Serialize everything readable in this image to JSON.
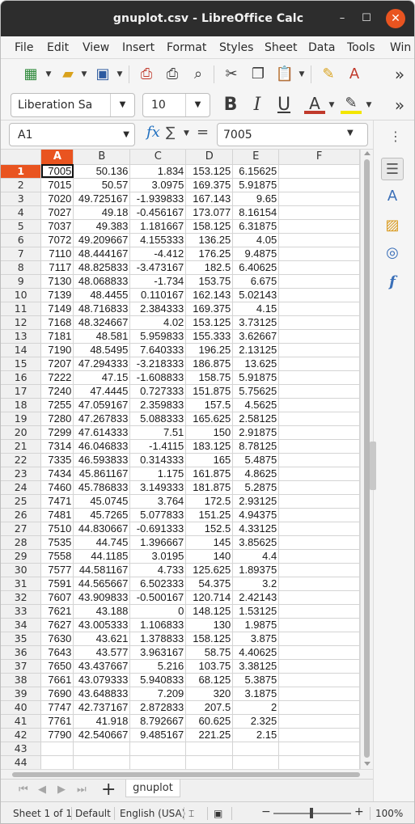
{
  "window": {
    "title": "gnuplot.csv - LibreOffice Calc",
    "min_glyph": "–",
    "max_glyph": "☐",
    "close_glyph": "✕"
  },
  "menu": [
    "File",
    "Edit",
    "View",
    "Insert",
    "Format",
    "Styles",
    "Sheet",
    "Data",
    "Tools",
    "Win"
  ],
  "toolbar": {
    "overflow": "»",
    "font_name": "Liberation Sa",
    "font_size": "10",
    "bold": "B",
    "italic": "I",
    "underline": "U"
  },
  "formula_bar": {
    "cell_ref": "A1",
    "fx": "fx",
    "sigma": "∑",
    "equals": "=",
    "value": "7005"
  },
  "grid": {
    "columns": [
      "A",
      "B",
      "C",
      "D",
      "E",
      "F"
    ],
    "rows": [
      [
        "1",
        "7005",
        "50.136",
        "1.834",
        "153.125",
        "6.15625",
        ""
      ],
      [
        "2",
        "7015",
        "50.57",
        "3.0975",
        "169.375",
        "5.91875",
        ""
      ],
      [
        "3",
        "7020",
        "49.725167",
        "-1.939833",
        "167.143",
        "9.65",
        ""
      ],
      [
        "4",
        "7027",
        "49.18",
        "-0.456167",
        "173.077",
        "8.16154",
        ""
      ],
      [
        "5",
        "7037",
        "49.383",
        "1.181667",
        "158.125",
        "6.31875",
        ""
      ],
      [
        "6",
        "7072",
        "49.209667",
        "4.155333",
        "136.25",
        "4.05",
        ""
      ],
      [
        "7",
        "7110",
        "48.444167",
        "-4.412",
        "176.25",
        "9.4875",
        ""
      ],
      [
        "8",
        "7117",
        "48.825833",
        "-3.473167",
        "182.5",
        "6.40625",
        ""
      ],
      [
        "9",
        "7130",
        "48.068833",
        "-1.734",
        "153.75",
        "6.675",
        ""
      ],
      [
        "10",
        "7139",
        "48.4455",
        "0.110167",
        "162.143",
        "5.02143",
        ""
      ],
      [
        "11",
        "7149",
        "48.716833",
        "2.384333",
        "169.375",
        "4.15",
        ""
      ],
      [
        "12",
        "7168",
        "48.324667",
        "4.02",
        "153.125",
        "3.73125",
        ""
      ],
      [
        "13",
        "7181",
        "48.581",
        "5.959833",
        "155.333",
        "3.62667",
        ""
      ],
      [
        "14",
        "7190",
        "48.5495",
        "7.640333",
        "196.25",
        "2.13125",
        ""
      ],
      [
        "15",
        "7207",
        "47.294333",
        "-3.218333",
        "186.875",
        "13.625",
        ""
      ],
      [
        "16",
        "7222",
        "47.15",
        "-1.608833",
        "158.75",
        "5.91875",
        ""
      ],
      [
        "17",
        "7240",
        "47.4445",
        "0.727333",
        "151.875",
        "5.75625",
        ""
      ],
      [
        "18",
        "7255",
        "47.059167",
        "2.359833",
        "157.5",
        "4.5625",
        ""
      ],
      [
        "19",
        "7280",
        "47.267833",
        "5.088333",
        "165.625",
        "2.58125",
        ""
      ],
      [
        "20",
        "7299",
        "47.614333",
        "7.51",
        "150",
        "2.91875",
        ""
      ],
      [
        "21",
        "7314",
        "46.046833",
        "-1.4115",
        "183.125",
        "8.78125",
        ""
      ],
      [
        "22",
        "7335",
        "46.593833",
        "0.314333",
        "165",
        "5.4875",
        ""
      ],
      [
        "23",
        "7434",
        "45.861167",
        "1.175",
        "161.875",
        "4.8625",
        ""
      ],
      [
        "24",
        "7460",
        "45.786833",
        "3.149333",
        "181.875",
        "5.2875",
        ""
      ],
      [
        "25",
        "7471",
        "45.0745",
        "3.764",
        "172.5",
        "2.93125",
        ""
      ],
      [
        "26",
        "7481",
        "45.7265",
        "5.077833",
        "151.25",
        "4.94375",
        ""
      ],
      [
        "27",
        "7510",
        "44.830667",
        "-0.691333",
        "152.5",
        "4.33125",
        ""
      ],
      [
        "28",
        "7535",
        "44.745",
        "1.396667",
        "145",
        "3.85625",
        ""
      ],
      [
        "29",
        "7558",
        "44.1185",
        "3.0195",
        "140",
        "4.4",
        ""
      ],
      [
        "30",
        "7577",
        "44.581167",
        "4.733",
        "125.625",
        "1.89375",
        ""
      ],
      [
        "31",
        "7591",
        "44.565667",
        "6.502333",
        "54.375",
        "3.2",
        ""
      ],
      [
        "32",
        "7607",
        "43.909833",
        "-0.500167",
        "120.714",
        "2.42143",
        ""
      ],
      [
        "33",
        "7621",
        "43.188",
        "0",
        "148.125",
        "1.53125",
        ""
      ],
      [
        "34",
        "7627",
        "43.005333",
        "1.106833",
        "130",
        "1.9875",
        ""
      ],
      [
        "35",
        "7630",
        "43.621",
        "1.378833",
        "158.125",
        "3.875",
        ""
      ],
      [
        "36",
        "7643",
        "43.577",
        "3.963167",
        "58.75",
        "4.40625",
        ""
      ],
      [
        "37",
        "7650",
        "43.437667",
        "5.216",
        "103.75",
        "3.38125",
        ""
      ],
      [
        "38",
        "7661",
        "43.079333",
        "5.940833",
        "68.125",
        "5.3875",
        ""
      ],
      [
        "39",
        "7690",
        "43.648833",
        "7.209",
        "320",
        "3.1875",
        ""
      ],
      [
        "40",
        "7747",
        "42.737167",
        "2.872833",
        "207.5",
        "2",
        ""
      ],
      [
        "41",
        "7761",
        "41.918",
        "8.792667",
        "60.625",
        "2.325",
        ""
      ],
      [
        "42",
        "7790",
        "42.540667",
        "9.485167",
        "221.25",
        "2.15",
        ""
      ],
      [
        "43",
        "",
        "",
        "",
        "",
        "",
        ""
      ],
      [
        "44",
        "",
        "",
        "",
        "",
        "",
        ""
      ]
    ]
  },
  "sheet_tabs": {
    "add": "+",
    "active": "gnuplot"
  },
  "status": {
    "sheet": "Sheet 1 of 1",
    "style": "Default",
    "language": "English (USA)",
    "zoom_minus": "−",
    "zoom_plus": "+",
    "zoom": "100%"
  },
  "colors": {
    "accent": "#e95420",
    "titlebar": "#2d2d2d",
    "formula_icon": "#1f6fbf"
  }
}
